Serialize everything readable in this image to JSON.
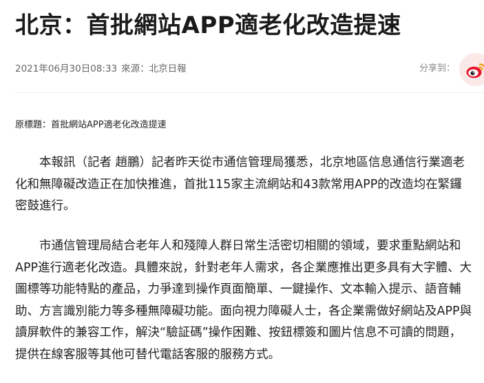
{
  "article": {
    "title": "北京：首批網站APP適老化改造提速",
    "date": "2021年06月30日08:33",
    "source_label": "來源：",
    "source": "北京日報",
    "share_label": "分享到：",
    "original_title": "原標題：首批網站APP適老化改造提速",
    "paragraphs": [
      "本報訊（記者 趙鵬）記者昨天從市通信管理局獲悉，北京地區信息通信行業適老化和無障礙改造正在加快推進，首批115家主流網站和43款常用APP的改造均在緊鑼密鼓進行。",
      "市通信管理局結合老年人和殘障人群日常生活密切相關的領域，要求重點網站和APP進行適老化改造。具體來說，針對老年人需求，各企業應推出更多具有大字體、大圖標等功能特點的產品，力爭達到操作頁面簡單、一鍵操作、文本輸入提示、語音輔助、方言識別能力等多種無障礙功能。面向視力障礙人士，各企業需做好網站及APP與讀屏軟件的兼容工作，解決“驗証碼”操作困難、按鈕標簽和圖片信息不可讀的問題，提供在線客服等其他可替代電話客服的服務方式。"
    ]
  },
  "share": {
    "weibo_icon": "weibo-icon",
    "weibo_bg": "#fbe9e8",
    "weibo_color": "#e6162d"
  }
}
